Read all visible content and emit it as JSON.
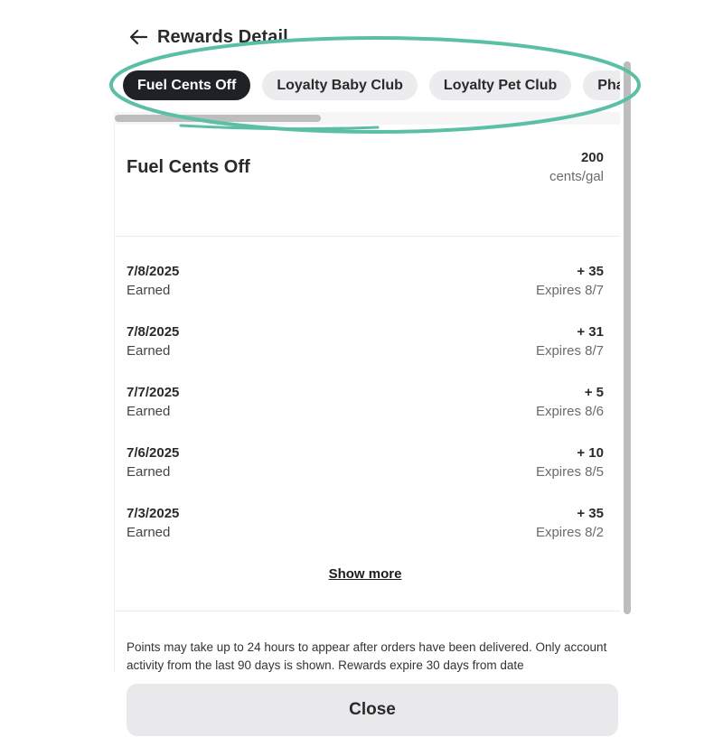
{
  "header": {
    "title": "Rewards Detail",
    "back_icon": "arrow-left-icon"
  },
  "tabs": [
    {
      "label": "Fuel Cents Off",
      "active": true
    },
    {
      "label": "Loyalty Baby Club",
      "active": false
    },
    {
      "label": "Loyalty Pet Club",
      "active": false
    },
    {
      "label": "Pha",
      "active": false
    }
  ],
  "summary": {
    "name": "Fuel Cents Off",
    "value": "200",
    "unit": "cents/gal"
  },
  "transactions": [
    {
      "date": "7/8/2025",
      "type": "Earned",
      "amount": "+ 35",
      "expires": "Expires 8/7"
    },
    {
      "date": "7/8/2025",
      "type": "Earned",
      "amount": "+ 31",
      "expires": "Expires 8/7"
    },
    {
      "date": "7/7/2025",
      "type": "Earned",
      "amount": "+ 5",
      "expires": "Expires 8/6"
    },
    {
      "date": "7/6/2025",
      "type": "Earned",
      "amount": "+ 10",
      "expires": "Expires 8/5"
    },
    {
      "date": "7/3/2025",
      "type": "Earned",
      "amount": "+ 35",
      "expires": "Expires 8/2"
    }
  ],
  "show_more_label": "Show more",
  "disclaimer": "Points may take up to 24 hours to appear after orders have been delivered. Only account activity from the last 90 days is shown. Rewards expire 30 days from date",
  "footer": {
    "close_label": "Close"
  },
  "colors": {
    "active_chip": "#1f2126",
    "chip": "#ececee",
    "highlight": "#5bbfa6",
    "close_button": "#e9e9eb"
  }
}
